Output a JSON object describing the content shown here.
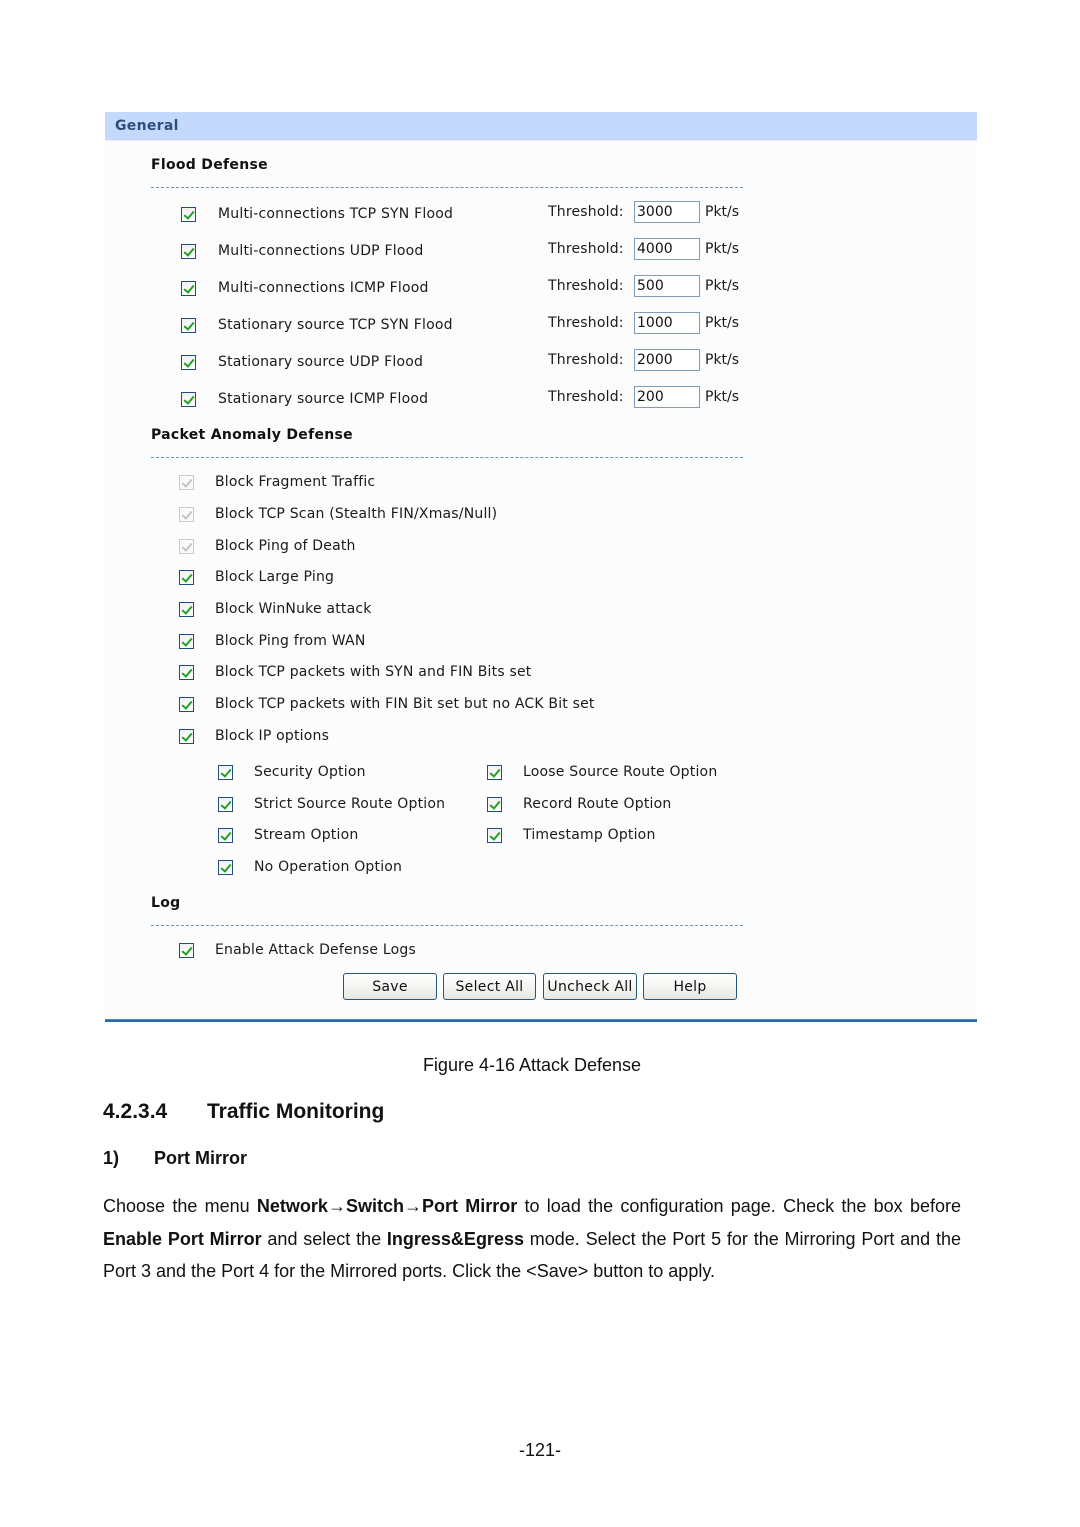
{
  "panel": {
    "header": "General",
    "flood_defense": {
      "title": "Flood Defense",
      "threshold_label": "Threshold:",
      "unit": "Pkt/s",
      "items": [
        {
          "label": "Multi-connections TCP SYN Flood",
          "checked": true,
          "threshold": "3000"
        },
        {
          "label": "Multi-connections UDP Flood",
          "checked": true,
          "threshold": "4000"
        },
        {
          "label": "Multi-connections ICMP Flood",
          "checked": true,
          "threshold": "500"
        },
        {
          "label": "Stationary source TCP SYN Flood",
          "checked": true,
          "threshold": "1000"
        },
        {
          "label": "Stationary source UDP Flood",
          "checked": true,
          "threshold": "2000"
        },
        {
          "label": "Stationary source ICMP Flood",
          "checked": true,
          "threshold": "200"
        }
      ]
    },
    "packet_anomaly": {
      "title": "Packet Anomaly Defense",
      "items": [
        {
          "label": "Block Fragment Traffic",
          "checked": true,
          "disabled": true
        },
        {
          "label": "Block TCP Scan (Stealth FIN/Xmas/Null)",
          "checked": true,
          "disabled": true
        },
        {
          "label": "Block Ping of Death",
          "checked": true,
          "disabled": true
        },
        {
          "label": "Block Large Ping",
          "checked": true,
          "disabled": false
        },
        {
          "label": "Block WinNuke attack",
          "checked": true,
          "disabled": false
        },
        {
          "label": "Block Ping from WAN",
          "checked": true,
          "disabled": false
        },
        {
          "label": "Block TCP packets with SYN and FIN Bits set",
          "checked": true,
          "disabled": false
        },
        {
          "label": "Block TCP packets with FIN Bit set but no ACK Bit set",
          "checked": true,
          "disabled": false
        },
        {
          "label": "Block IP options",
          "checked": true,
          "disabled": false
        }
      ],
      "ip_options": [
        {
          "label": "Security Option",
          "checked": true
        },
        {
          "label": "Loose Source Route Option",
          "checked": true
        },
        {
          "label": "Strict Source Route Option",
          "checked": true
        },
        {
          "label": "Record Route Option",
          "checked": true
        },
        {
          "label": "Stream Option",
          "checked": true
        },
        {
          "label": "Timestamp Option",
          "checked": true
        },
        {
          "label": "No Operation Option",
          "checked": true
        }
      ]
    },
    "log": {
      "title": "Log",
      "item": {
        "label": "Enable Attack Defense Logs",
        "checked": true
      }
    },
    "buttons": {
      "save": "Save",
      "select_all": "Select All",
      "uncheck_all": "Uncheck All",
      "help": "Help"
    }
  },
  "document": {
    "figure_caption": "Figure 4-16 Attack Defense",
    "section_number": "4.2.3.4",
    "section_title": "Traffic Monitoring",
    "subsection_number": "1)",
    "subsection_title": "Port Mirror",
    "paragraph": {
      "t1": "Choose the menu ",
      "b1": "Network→Switch→Port Mirror",
      "t2": " to load the configuration page. Check the box before ",
      "b2": "Enable Port Mirror",
      "t3": " and select the ",
      "b3": "Ingress&Egress",
      "t4": " mode. Select the Port 5 for the Mirroring Port and the Port 3 and the Port 4 for the Mirrored ports. Click the <Save> button to apply."
    },
    "page_number": "-121-"
  }
}
